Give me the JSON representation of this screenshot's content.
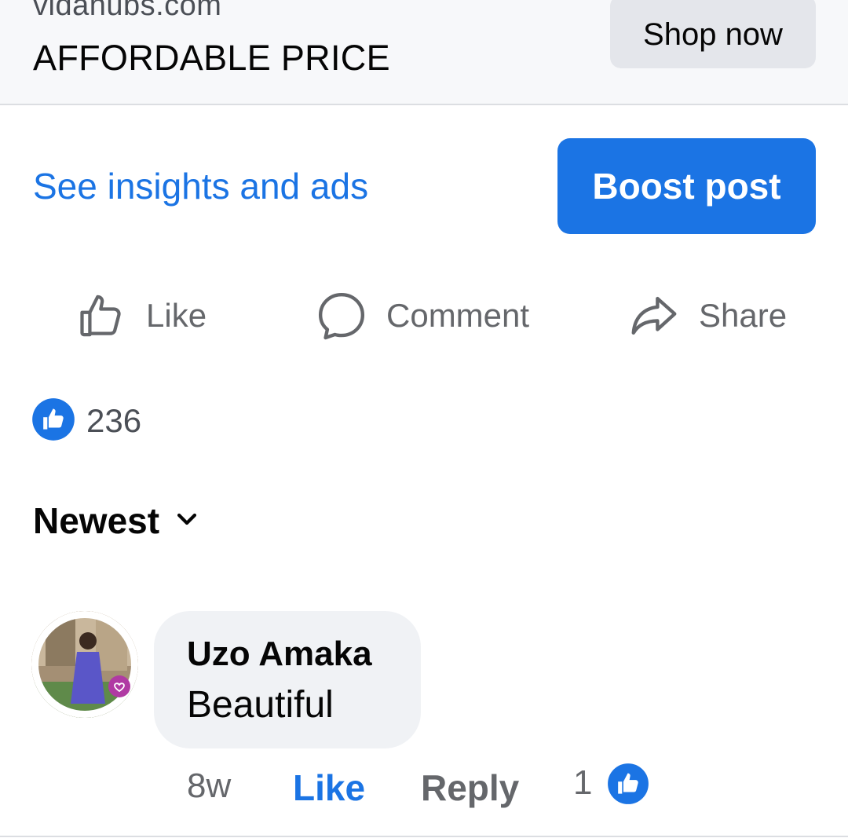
{
  "ad": {
    "domain": "vidahubs.com",
    "headline": "AFFORDABLE PRICE",
    "cta_label": "Shop now"
  },
  "post_tools": {
    "insights_label": "See insights and ads",
    "boost_label": "Boost post"
  },
  "actions": {
    "like_label": "Like",
    "comment_label": "Comment",
    "share_label": "Share"
  },
  "reactions": {
    "count": "236"
  },
  "comments_sort": {
    "label": "Newest"
  },
  "comments": [
    {
      "author": "Uzo Amaka",
      "text": "Beautiful",
      "time": "8w",
      "like_label": "Like",
      "reply_label": "Reply",
      "reaction_count": "1"
    }
  ],
  "colors": {
    "accent": "#1b74e4",
    "secondary_text": "#65676b",
    "bubble": "#f0f2f5"
  }
}
